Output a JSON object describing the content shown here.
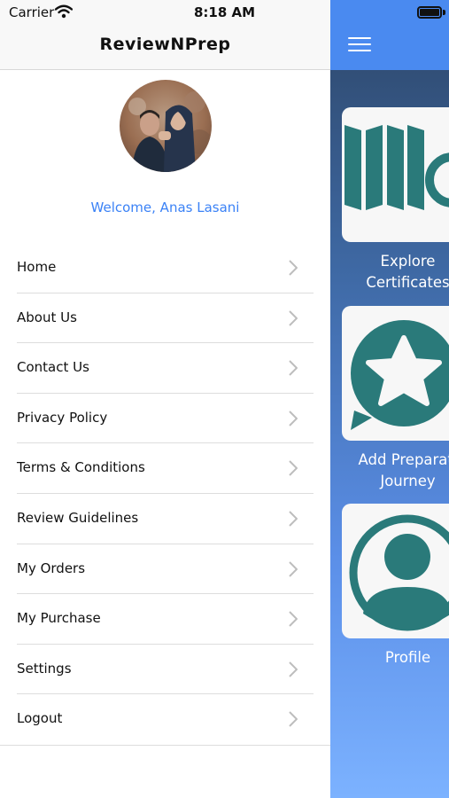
{
  "status_bar": {
    "carrier": "Carrier",
    "time": "8:18 AM",
    "wifi_icon": "wifi-icon",
    "battery_icon": "battery-icon"
  },
  "menu": {
    "title": "ReviewNPrep",
    "welcome": "Welcome, Anas Lasani",
    "items": [
      {
        "label": "Home"
      },
      {
        "label": "About Us"
      },
      {
        "label": "Contact Us"
      },
      {
        "label": "Privacy Policy"
      },
      {
        "label": "Terms & Conditions"
      },
      {
        "label": "Review Guidelines"
      },
      {
        "label": "My Orders"
      },
      {
        "label": "My Purchase"
      },
      {
        "label": "Settings"
      },
      {
        "label": "Logout"
      }
    ],
    "chevron_icon": "chevron-right-icon"
  },
  "main": {
    "menu_icon": "hamburger-icon",
    "cards": [
      {
        "line1": "Explore",
        "line2": "Certificates",
        "icon": "certificates-icon"
      },
      {
        "line1": "Add Preparati",
        "line2": "Journey",
        "icon": "star-chat-icon"
      },
      {
        "line1": "Profile",
        "line2": "",
        "icon": "profile-icon"
      }
    ]
  },
  "colors": {
    "accent_blue": "#3b82f6",
    "nav_blue": "#4a8af0",
    "icon_teal": "#2a7a7a"
  }
}
